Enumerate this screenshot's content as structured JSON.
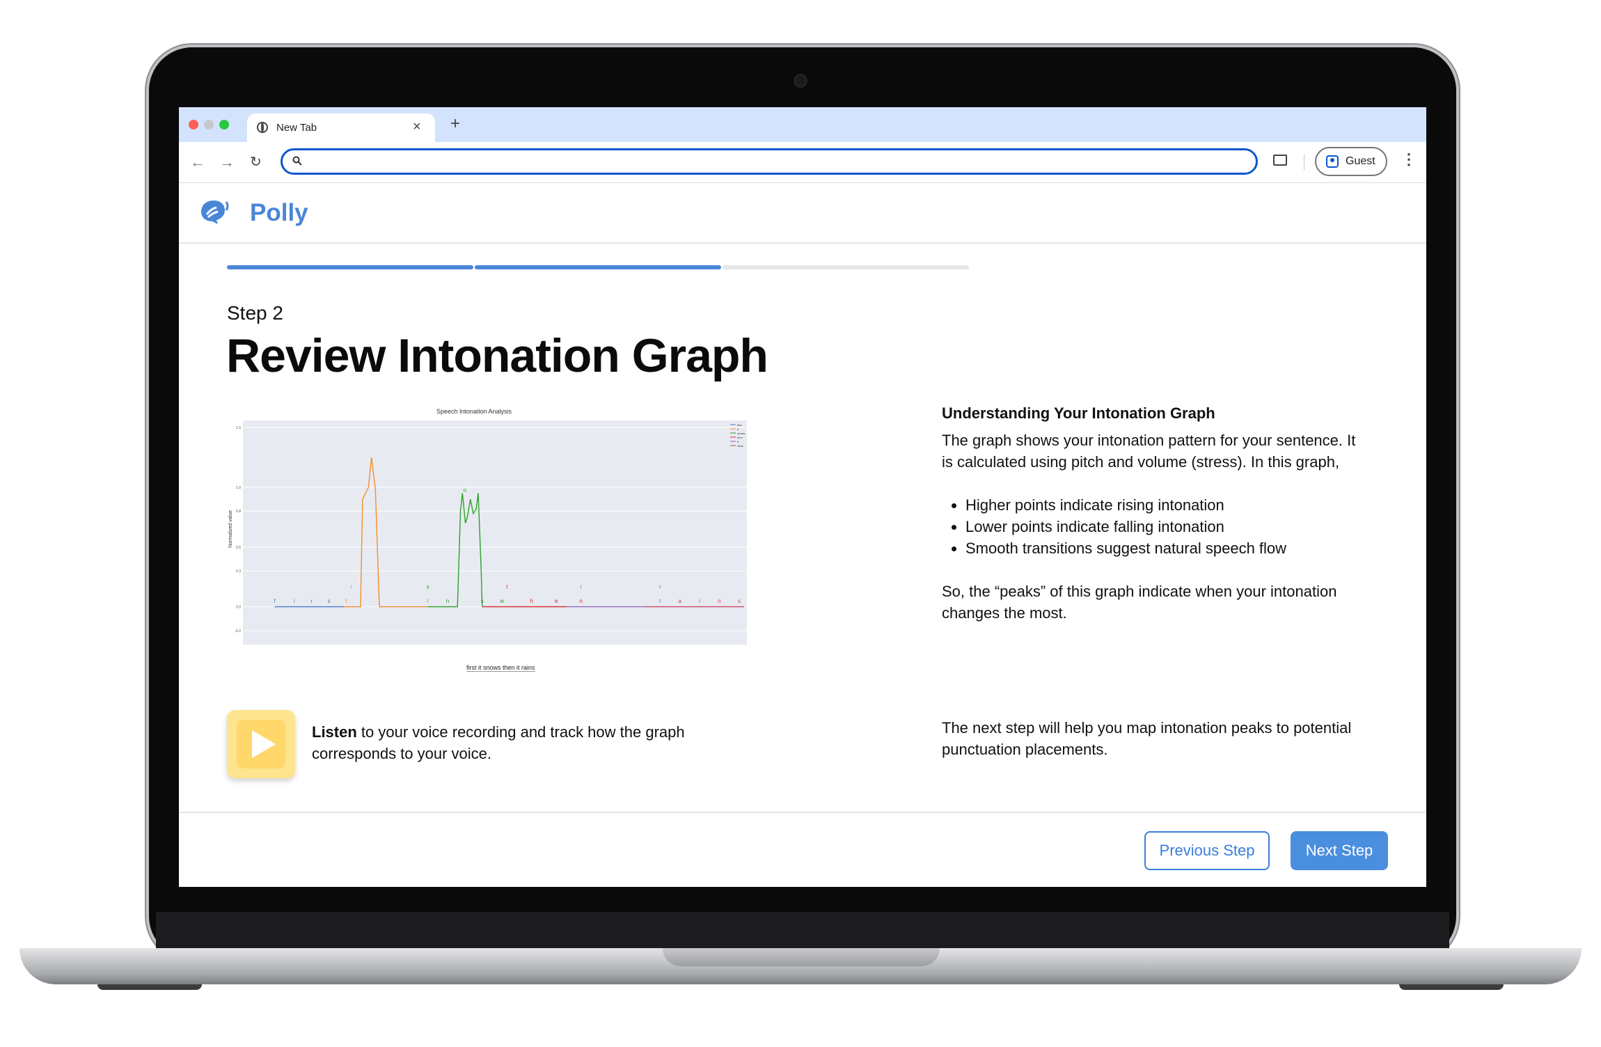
{
  "browser": {
    "tab_title": "New Tab",
    "new_tab_symbol": "+",
    "close_symbol": "×",
    "search_placeholder": "",
    "profile_label": "Guest",
    "traffic_colors": [
      "#ff5f57",
      "#c6c8cc",
      "#28c840"
    ]
  },
  "app": {
    "name": "Polly",
    "brand_color": "#4a86d8",
    "progress_steps": [
      {
        "state": "complete"
      },
      {
        "state": "complete"
      },
      {
        "state": "incomplete"
      }
    ],
    "progress_colors": {
      "complete": "#4a86d8",
      "incomplete": "#e6e7e9"
    }
  },
  "step": {
    "label": "Step 2",
    "title": "Review Intonation Graph"
  },
  "listen": {
    "bold": "Listen",
    "rest": " to your voice recording and track how the graph corresponds to your voice."
  },
  "explanation": {
    "heading": "Understanding Your Intonation Graph",
    "intro": "The graph shows your intonation pattern for your sentence. It is calculated using pitch and volume (stress). In this graph,",
    "bullets": [
      "Higher points indicate rising intonation",
      "Lower points indicate falling intonation",
      "Smooth transitions suggest natural speech flow"
    ],
    "summary": "So, the “peaks” of this graph indicate when your intonation changes the most.",
    "next_note": "The next step will help you map intonation peaks to potential punctuation placements."
  },
  "nav": {
    "previous_label": "Previous Step",
    "next_label": "Next Step"
  },
  "chart_data": {
    "type": "line",
    "title": "Speech Intonation Analysis",
    "ylabel": "Normalized value",
    "caption": "first it snows then it rains",
    "yticks": [
      "1.5",
      "1.0",
      "0.8",
      "0.5",
      "0.3",
      "0.0",
      "-0.2"
    ],
    "ylim": [
      -0.2,
      1.5
    ],
    "xlim": [
      0,
      100
    ],
    "grid": true,
    "legend_position": "top-right",
    "legend": [
      {
        "name": "first",
        "color": "#4e79c7"
      },
      {
        "name": "it",
        "color": "#f28e2b"
      },
      {
        "name": "snows",
        "color": "#2ca02c"
      },
      {
        "name": "then",
        "color": "#d62728"
      },
      {
        "name": "it",
        "color": "#9467bd"
      },
      {
        "name": "rains",
        "color": "#c9456a"
      }
    ],
    "series": [
      {
        "name": "first",
        "color": "#4e79c7",
        "points": [
          [
            5,
            0
          ],
          [
            19,
            0
          ]
        ]
      },
      {
        "name": "it",
        "color": "#f28e2b",
        "points": [
          [
            19,
            0
          ],
          [
            22.4,
            0
          ],
          [
            22.8,
            0.9
          ],
          [
            23.4,
            0.95
          ],
          [
            24,
            1.0
          ],
          [
            24.6,
            1.25
          ],
          [
            25.4,
            0.98
          ],
          [
            26.2,
            0
          ],
          [
            36,
            0
          ]
        ]
      },
      {
        "name": "snows",
        "color": "#2ca02c",
        "points": [
          [
            36,
            0
          ],
          [
            42,
            0
          ],
          [
            42.6,
            0.8
          ],
          [
            43,
            0.95
          ],
          [
            43.6,
            0.7
          ],
          [
            44,
            0.75
          ],
          [
            44.6,
            0.9
          ],
          [
            45.2,
            0.78
          ],
          [
            45.8,
            0.82
          ],
          [
            46.2,
            0.95
          ],
          [
            46.8,
            0.3
          ],
          [
            47,
            0
          ]
        ]
      },
      {
        "name": "then",
        "color": "#d62728",
        "points": [
          [
            47,
            0
          ],
          [
            64,
            0
          ]
        ]
      },
      {
        "name": "it",
        "color": "#9467bd",
        "points": [
          [
            64,
            0
          ],
          [
            80,
            0
          ]
        ]
      },
      {
        "name": "rains",
        "color": "#c9456a",
        "points": [
          [
            80,
            0
          ],
          [
            100,
            0
          ]
        ]
      }
    ],
    "letter_labels": [
      {
        "t": "f",
        "x": 5,
        "y": 0.02,
        "c": "#4e79c7"
      },
      {
        "t": "i",
        "x": 9,
        "y": 0.02,
        "c": "#4e79c7"
      },
      {
        "t": "r",
        "x": 12.5,
        "y": 0.02,
        "c": "#4e79c7"
      },
      {
        "t": "s",
        "x": 16,
        "y": 0.02,
        "c": "#4e79c7"
      },
      {
        "t": "t",
        "x": 19.5,
        "y": 0.02,
        "c": "#f28e2b"
      },
      {
        "t": "i",
        "x": 20.5,
        "y": 0.14,
        "c": "#f28e2b"
      },
      {
        "t": "t",
        "x": 36,
        "y": 0.02,
        "c": "#f28e2b"
      },
      {
        "t": "s",
        "x": 36,
        "y": 0.14,
        "c": "#2ca02c"
      },
      {
        "t": "n",
        "x": 40,
        "y": 0.02,
        "c": "#2ca02c"
      },
      {
        "t": "o",
        "x": 43.5,
        "y": 0.95,
        "c": "#2ca02c"
      },
      {
        "t": "w",
        "x": 51,
        "y": 0.02,
        "c": "#2ca02c"
      },
      {
        "t": "s",
        "x": 47,
        "y": 0.02,
        "c": "#2ca02c"
      },
      {
        "t": "t",
        "x": 52,
        "y": 0.14,
        "c": "#d62728"
      },
      {
        "t": "h",
        "x": 57,
        "y": 0.02,
        "c": "#d62728"
      },
      {
        "t": "e",
        "x": 62,
        "y": 0.02,
        "c": "#d62728"
      },
      {
        "t": "n",
        "x": 67,
        "y": 0.02,
        "c": "#d62728"
      },
      {
        "t": "i",
        "x": 67,
        "y": 0.14,
        "c": "#9467bd"
      },
      {
        "t": "t",
        "x": 83,
        "y": 0.02,
        "c": "#9467bd"
      },
      {
        "t": "r",
        "x": 83,
        "y": 0.14,
        "c": "#c9456a"
      },
      {
        "t": "a",
        "x": 87,
        "y": 0.02,
        "c": "#c9456a"
      },
      {
        "t": "i",
        "x": 91,
        "y": 0.02,
        "c": "#c9456a"
      },
      {
        "t": "n",
        "x": 95,
        "y": 0.02,
        "c": "#c9456a"
      },
      {
        "t": "s",
        "x": 99,
        "y": 0.02,
        "c": "#c9456a"
      }
    ]
  }
}
